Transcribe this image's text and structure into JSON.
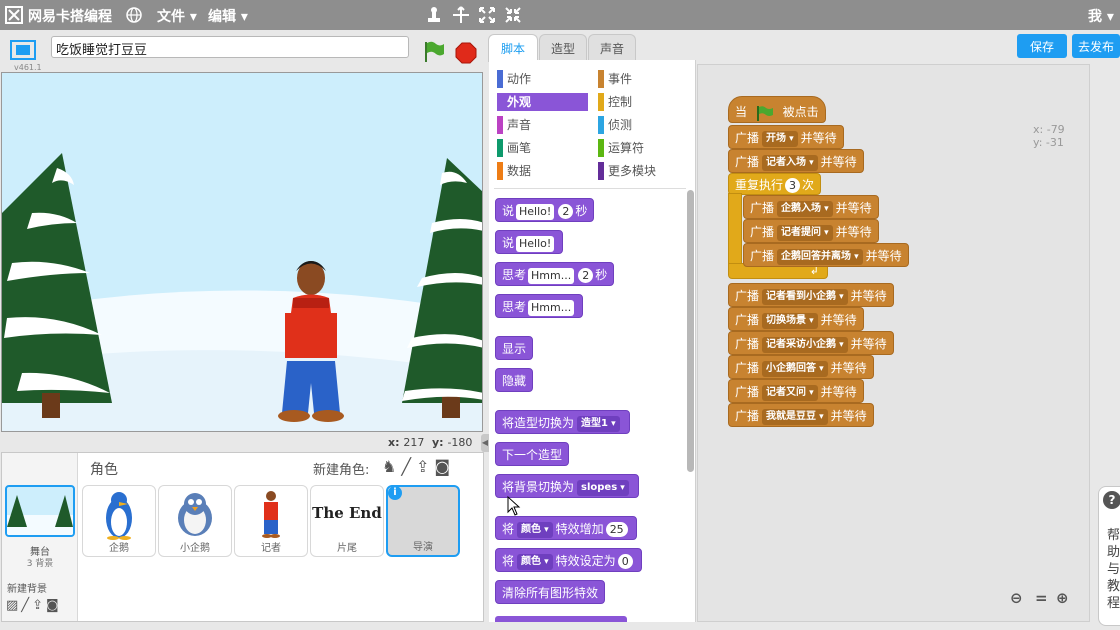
{
  "menubar": {
    "brand": "网易卡搭编程",
    "file": "文件",
    "edit": "编辑",
    "user": "我"
  },
  "project": {
    "title": "吃饭睡觉打豆豆",
    "version": "v461.1"
  },
  "stage": {
    "x_label": "x:",
    "x": "217",
    "y_label": "y:",
    "y": "-180"
  },
  "tabs": {
    "scripts": "脚本",
    "costumes": "造型",
    "sounds": "声音"
  },
  "buttons": {
    "save": "保存",
    "publish": "去发布"
  },
  "categories": {
    "motion": "动作",
    "looks": "外观",
    "sound": "声音",
    "pen": "画笔",
    "data": "数据",
    "events": "事件",
    "control": "控制",
    "sensing": "侦测",
    "operators": "运算符",
    "more": "更多模块"
  },
  "palette": {
    "say_secs": {
      "a": "说",
      "s": "Hello!",
      "n": "2",
      "b": "秒"
    },
    "say": {
      "a": "说",
      "s": "Hello!"
    },
    "think_secs": {
      "a": "思考",
      "s": "Hmm...",
      "n": "2",
      "b": "秒"
    },
    "think": {
      "a": "思考",
      "s": "Hmm..."
    },
    "show": "显示",
    "hide": "隐藏",
    "switch_costume": {
      "a": "将造型切换为",
      "d": "造型1"
    },
    "next_costume": "下一个造型",
    "switch_backdrop": {
      "a": "将背景切换为",
      "d": "slopes"
    },
    "change_effect": {
      "a": "将",
      "d": "颜色",
      "b": "特效增加",
      "n": "25"
    },
    "set_effect": {
      "a": "将",
      "d": "颜色",
      "b": "特效设定为",
      "n": "0"
    },
    "clear_effects": "清除所有图形特效"
  },
  "script": {
    "hat_a": "当",
    "hat_b": "被点击",
    "bc": "广播",
    "wait": "并等待",
    "repeat_a": "重复执行",
    "repeat_n": "3",
    "repeat_b": "次",
    "msgs": [
      "开场",
      "记者入场",
      "企鹅入场",
      "记者提问",
      "企鹅回答并离场",
      "记者看到小企鹅",
      "切换场景",
      "记者采访小企鹅",
      "小企鹅回答",
      "记者又问",
      "我就是豆豆"
    ],
    "coords": {
      "x_label": "x:",
      "x": "-79",
      "y_label": "y:",
      "y": "-31"
    }
  },
  "sprites_panel": {
    "header": "角色",
    "new_sprite": "新建角色:",
    "stage_label": "舞台",
    "stage_bg": "3 背景",
    "new_backdrop": "新建背景",
    "items": [
      "企鹅",
      "小企鹅",
      "记者",
      "片尾",
      "导演"
    ],
    "the_end": "The End"
  },
  "help": {
    "text": "帮助与教程"
  },
  "colors": {
    "looks": "#8a55d7",
    "events": "#c88330",
    "control": "#e1a91a",
    "accent": "#1e9df2"
  }
}
